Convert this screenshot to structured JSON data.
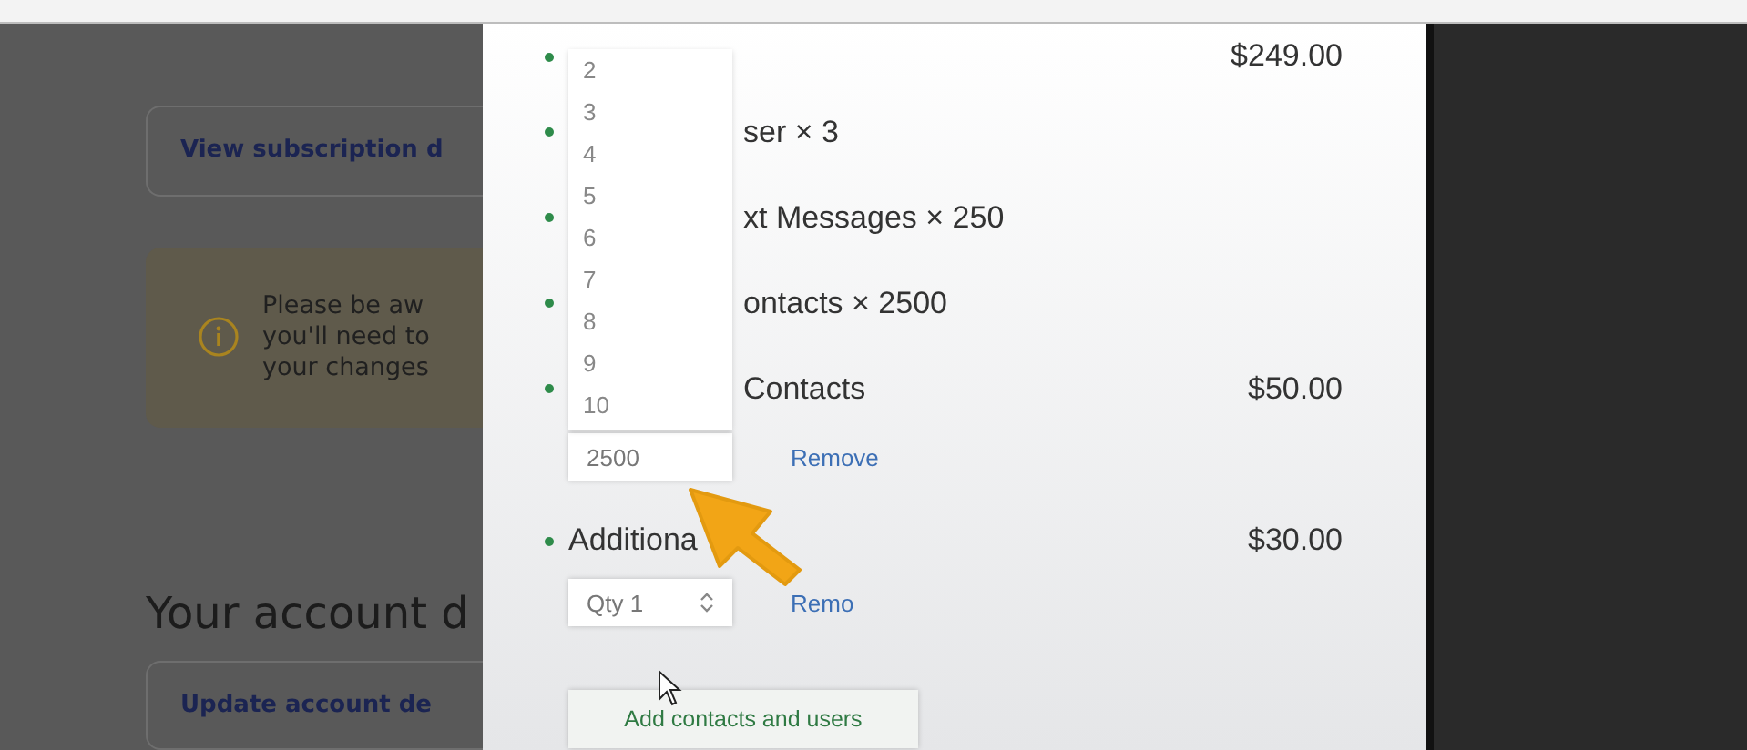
{
  "background_page": {
    "subscription_button": "View subscription d",
    "notice_lines": [
      "Please be aw",
      "you'll need to",
      "your changes"
    ],
    "account_heading": "Your account d",
    "account_button": "Update account de"
  },
  "panel": {
    "items": [
      {
        "price": "$249.00"
      },
      {
        "name": "ser × 3"
      },
      {
        "name": "xt Messages × 250"
      },
      {
        "name": "ontacts × 2500"
      },
      {
        "name": "Contacts",
        "price": "$50.00",
        "control": {
          "kind": "input",
          "value": "2500",
          "link": "Remove"
        }
      },
      {
        "name": "Additiona",
        "price": "$30.00",
        "control": {
          "kind": "select",
          "value": "Qty 1",
          "link": "Remo"
        }
      }
    ],
    "dropdown_options": [
      "2",
      "3",
      "4",
      "5",
      "6",
      "7",
      "8",
      "9",
      "10"
    ],
    "add_button": "Add contacts and users"
  }
}
